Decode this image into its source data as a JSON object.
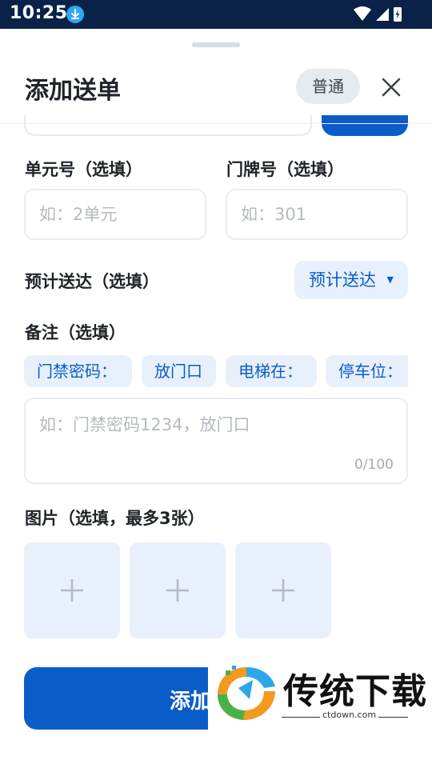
{
  "status_bar": {
    "time": "10:25",
    "icons": [
      "download-icon",
      "wifi-icon",
      "signal-icon",
      "battery-icon"
    ]
  },
  "header": {
    "title": "添加送单",
    "badge": "普通"
  },
  "unit_field": {
    "label": "单元号（选填）",
    "placeholder": "如：2单元"
  },
  "door_field": {
    "label": "门牌号（选填）",
    "placeholder": "如：301"
  },
  "eta": {
    "label": "预计送达（选填）",
    "button": "预计送达"
  },
  "remark": {
    "label": "备注（选填）",
    "chips": [
      "门禁密码：",
      "放门口",
      "电梯在：",
      "停车位："
    ],
    "placeholder": "如：门禁密码1234，放门口",
    "counter": "0/100"
  },
  "photos": {
    "label": "图片（选填，最多3张）",
    "slots": 3
  },
  "submit": {
    "label": "添加"
  },
  "watermark": {
    "text": "传统下载",
    "url": "ctdown.com"
  },
  "colors": {
    "primary": "#0a5cc9",
    "chip_bg": "#e8f0fc",
    "status_bar": "#0a2247"
  }
}
